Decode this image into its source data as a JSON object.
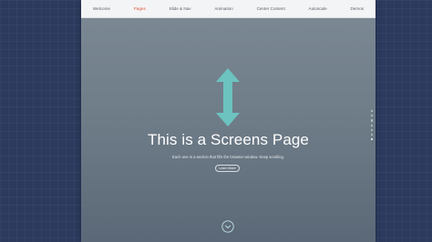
{
  "nav": {
    "items": [
      {
        "label": "Welcome"
      },
      {
        "label": "Pages"
      },
      {
        "label": "Slide & Nav"
      },
      {
        "label": "Animation"
      },
      {
        "label": "Center Content"
      },
      {
        "label": "Autoscale"
      },
      {
        "label": "Demos"
      }
    ],
    "active_index": 1
  },
  "hero": {
    "title": "This is a Screens Page",
    "subtitle": "Each one is a section that fills the browser window. Keep scrolling.",
    "button_label": "Learn More"
  },
  "section_dots": {
    "count": 7,
    "active_index": 6
  },
  "colors": {
    "accent": "#e2553c",
    "arrow": "#6cc3c0",
    "page_background": "#2c3a5e"
  },
  "icons": {
    "arrow": "double-arrow-vertical-icon",
    "scroll": "chevron-down-circle-icon"
  }
}
